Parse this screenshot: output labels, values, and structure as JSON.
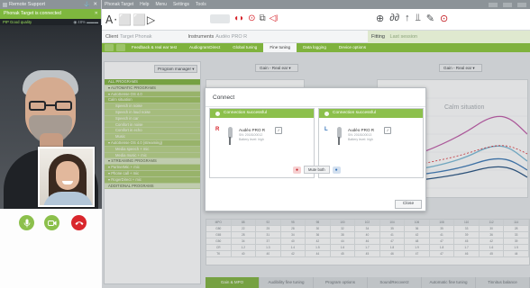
{
  "left_panel": {
    "title": "Remote Support",
    "window_controls": "⚓ ✕",
    "connected_message": "Phonak Target is connected",
    "close_symbol": "✕",
    "status_left": "PIP   Good quality",
    "status_right": "◉ 48% ▬▬▬"
  },
  "app": {
    "titlebar_text": "Phonak Target",
    "titlebar_items": [
      "Help",
      "Menu",
      "Settings",
      "Tools"
    ],
    "client_label": "Client",
    "client_value": "Target Phonak",
    "instruments_label": "Instruments",
    "instruments_value": "Audéo PRO R",
    "fitting_label": "Fitting",
    "fitting_value": "Last session",
    "tabs": [
      "Feedback & real ear test",
      "AudiogramDirect",
      "Global tuning",
      "Fine tuning",
      "Data logging",
      "Device options"
    ],
    "active_tab_index": 3,
    "program_manager": "Program manager ▾",
    "gain_left": "Gain - Real ear ▾",
    "gain_right": "Gain - Real ear ▾",
    "chart_title": "Calm situation",
    "program_list": [
      {
        "label": "ALL PROGRAMS",
        "kind": "head"
      },
      {
        "label": "▾ AUTOMATIC PROGRAMS",
        "kind": "dark"
      },
      {
        "label": "▾ AutoSense OS 4.0",
        "kind": "row"
      },
      {
        "label": "Calm situation",
        "kind": "sel"
      },
      {
        "label": "Speech in noise",
        "kind": "sub"
      },
      {
        "label": "Speech in loud noise",
        "kind": "sub"
      },
      {
        "label": "Speech in car",
        "kind": "sub"
      },
      {
        "label": "Comfort in noise",
        "kind": "sub"
      },
      {
        "label": "Comfort in echo",
        "kind": "sub"
      },
      {
        "label": "Music",
        "kind": "sub"
      },
      {
        "label": "▾ AutoSense OS 4.0 (streaming)",
        "kind": "row"
      },
      {
        "label": "Media speech + mic",
        "kind": "sub"
      },
      {
        "label": "Media music + mic",
        "kind": "sub"
      },
      {
        "label": "▾ STREAMING PROGRAMS",
        "kind": "dark"
      },
      {
        "label": "▾ PartnerMic + mic",
        "kind": "row"
      },
      {
        "label": "▾ Phone call + mic",
        "kind": "row"
      },
      {
        "label": "▾ RogerDirect + mic",
        "kind": "row"
      },
      {
        "label": "ADDITIONAL PROGRAMS",
        "kind": "dark"
      }
    ],
    "bottom_tabs": [
      "Gain & MPO",
      "Audibility fine tuning",
      "Program options",
      "SoundRecover2",
      "Automatic fine tuning",
      "Tinnitus balance"
    ]
  },
  "modal": {
    "title": "Connect",
    "panels": [
      {
        "status": "Connection successful",
        "side": "R",
        "device": "Audéo PRO R",
        "sub1": "SN: 2018100012",
        "sub2": "Battery level: high"
      },
      {
        "status": "Connection successful",
        "side": "L",
        "device": "Audéo PRO R",
        "sub1": "SN: 2018100013",
        "sub2": "Battery level: high"
      }
    ],
    "mute_label": "Mute both",
    "close_label": "Close"
  },
  "colors": {
    "accent": "#7fb23d",
    "right_ear": "#d7242c",
    "left_ear": "#2f6fb7",
    "end_call": "#d9262c"
  },
  "grid_rows": [
    [
      "MPO",
      "88",
      "92",
      "95",
      "98",
      "100",
      "102",
      "104",
      "106",
      "108",
      "110",
      "112",
      "114"
    ],
    [
      "G80",
      "22",
      "25",
      "28",
      "30",
      "32",
      "34",
      "35",
      "36",
      "35",
      "33",
      "30",
      "28"
    ],
    [
      "G65",
      "28",
      "31",
      "34",
      "36",
      "38",
      "40",
      "41",
      "42",
      "41",
      "39",
      "36",
      "33"
    ],
    [
      "G50",
      "34",
      "37",
      "40",
      "42",
      "44",
      "46",
      "47",
      "48",
      "47",
      "45",
      "42",
      "39"
    ],
    [
      "CR",
      "1.2",
      "1.3",
      "1.4",
      "1.5",
      "1.6",
      "1.7",
      "1.8",
      "1.9",
      "1.8",
      "1.7",
      "1.6",
      "1.5"
    ],
    [
      "TK",
      "40",
      "40",
      "42",
      "44",
      "45",
      "45",
      "46",
      "47",
      "47",
      "46",
      "45",
      "44"
    ]
  ]
}
